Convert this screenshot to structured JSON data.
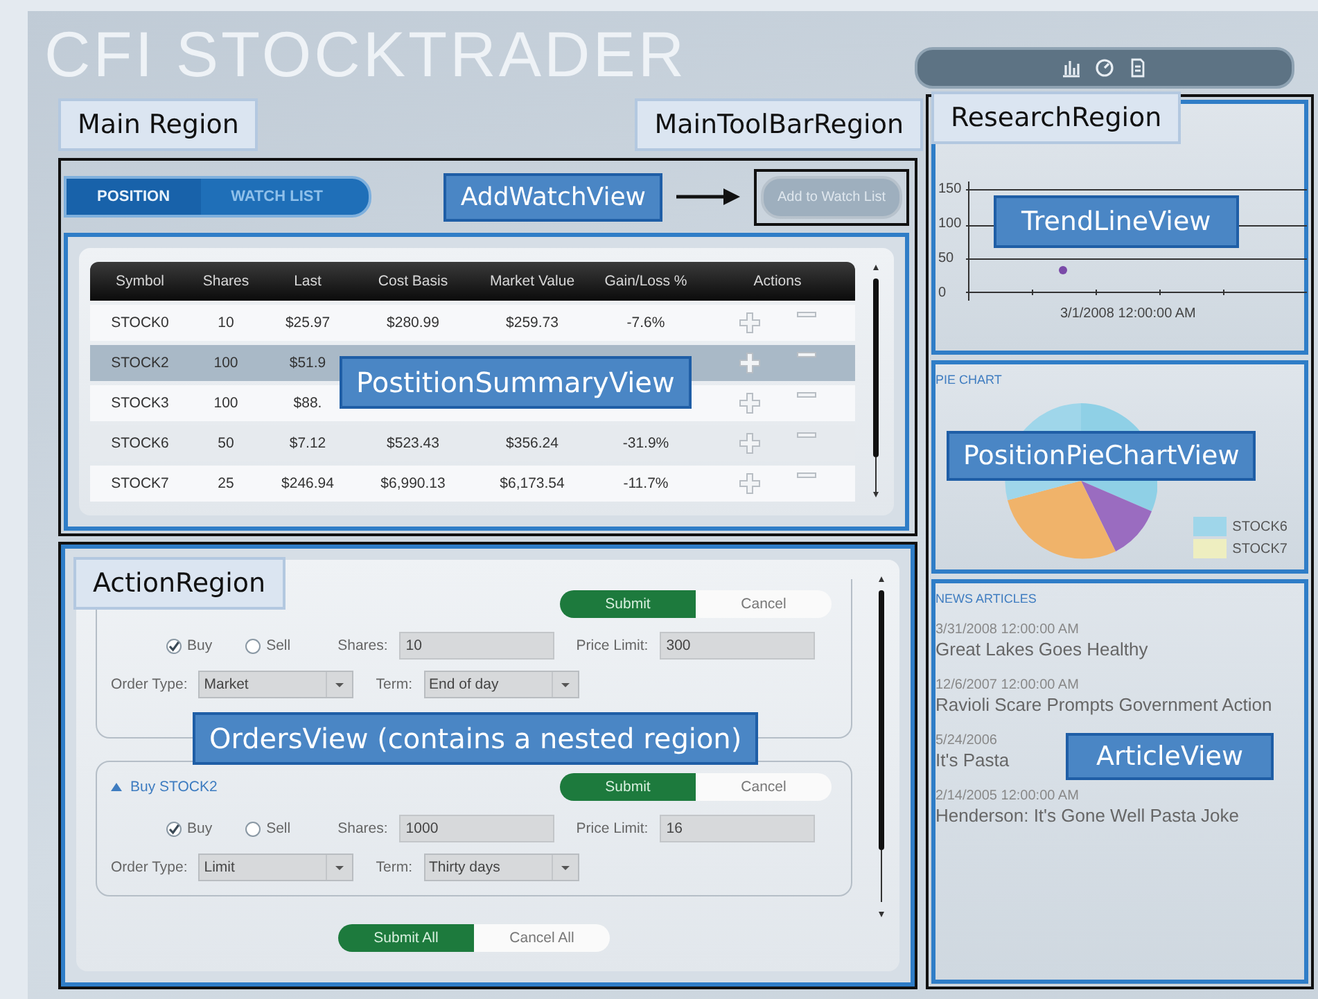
{
  "app_title": "CFI STOCKTRADER",
  "main_region": {
    "annotation": "Main Region",
    "toolbar_annotation": "MainToolBarRegion",
    "tabs": [
      {
        "label": "POSITION",
        "selected": true
      },
      {
        "label": "WATCH LIST",
        "selected": false
      }
    ],
    "add_watch": {
      "annotation": "AddWatchView",
      "button": "Add to Watch List"
    },
    "positions": {
      "annotation": "PostitionSummaryView",
      "columns": [
        "Symbol",
        "Shares",
        "Last",
        "Cost Basis",
        "Market Value",
        "Gain/Loss %",
        "Actions"
      ],
      "rows": [
        {
          "symbol": "STOCK0",
          "shares": "10",
          "last": "$25.97",
          "cost_basis": "$280.99",
          "market_value": "$259.73",
          "gain_loss": "-7.6%",
          "selected": false
        },
        {
          "symbol": "STOCK2",
          "shares": "100",
          "last": "$51.9",
          "selected": true
        },
        {
          "symbol": "STOCK3",
          "shares": "100",
          "last": "$88.",
          "selected": false
        },
        {
          "symbol": "STOCK6",
          "shares": "50",
          "last": "$7.12",
          "cost_basis": "$523.43",
          "market_value": "$356.24",
          "gain_loss": "-31.9%",
          "selected": false
        },
        {
          "symbol": "STOCK7",
          "shares": "25",
          "last": "$246.94",
          "cost_basis": "$6,990.13",
          "market_value": "$6,173.54",
          "gain_loss": "-11.7%",
          "selected": false
        }
      ]
    }
  },
  "action_region": {
    "annotation": "ActionRegion",
    "view_annotation": "OrdersView (contains a nested region)",
    "orders": [
      {
        "submit": "Submit",
        "cancel": "Cancel",
        "sides": [
          {
            "label": "Buy",
            "selected": true
          },
          {
            "label": "Sell",
            "selected": false
          }
        ],
        "shares_label": "Shares:",
        "shares": "10",
        "price_label": "Price Limit:",
        "price": "300",
        "type_label": "Order Type:",
        "type": "Market",
        "term_label": "Term:",
        "term": "End of day"
      },
      {
        "header": "Buy STOCK2",
        "submit": "Submit",
        "cancel": "Cancel",
        "sides": [
          {
            "label": "Buy",
            "selected": true
          },
          {
            "label": "Sell",
            "selected": false
          }
        ],
        "shares_label": "Shares:",
        "shares": "1000",
        "price_label": "Price Limit:",
        "price": "16",
        "type_label": "Order Type:",
        "type": "Limit",
        "term_label": "Term:",
        "term": "Thirty days"
      }
    ],
    "submit_all": "Submit All",
    "cancel_all": "Cancel All"
  },
  "research_region": {
    "annotation": "ResearchRegion",
    "trend": {
      "annotation": "TrendLineView",
      "y_labels": [
        "150",
        "100",
        "50",
        "0"
      ],
      "x_label": "3/1/2008 12:00:00 AM"
    },
    "pie": {
      "title": "PIE CHART",
      "annotation": "PositionPieChartView",
      "legend": [
        {
          "label": "STOCK6",
          "color": "#9fd6ea"
        },
        {
          "label": "STOCK7",
          "color": "#eeeec0"
        }
      ]
    },
    "news": {
      "title": "NEWS ARTICLES",
      "annotation": "ArticleView",
      "articles": [
        {
          "date": "3/31/2008 12:00:00 AM",
          "title": "Great Lakes Goes Healthy"
        },
        {
          "date": "12/6/2007 12:00:00 AM",
          "title": "Ravioli Scare Prompts Government Action"
        },
        {
          "date": "5/24/2006",
          "title": "It's Pasta"
        },
        {
          "date": "2/14/2005 12:00:00 AM",
          "title": "Henderson: It's Gone Well Pasta Joke"
        }
      ]
    }
  }
}
